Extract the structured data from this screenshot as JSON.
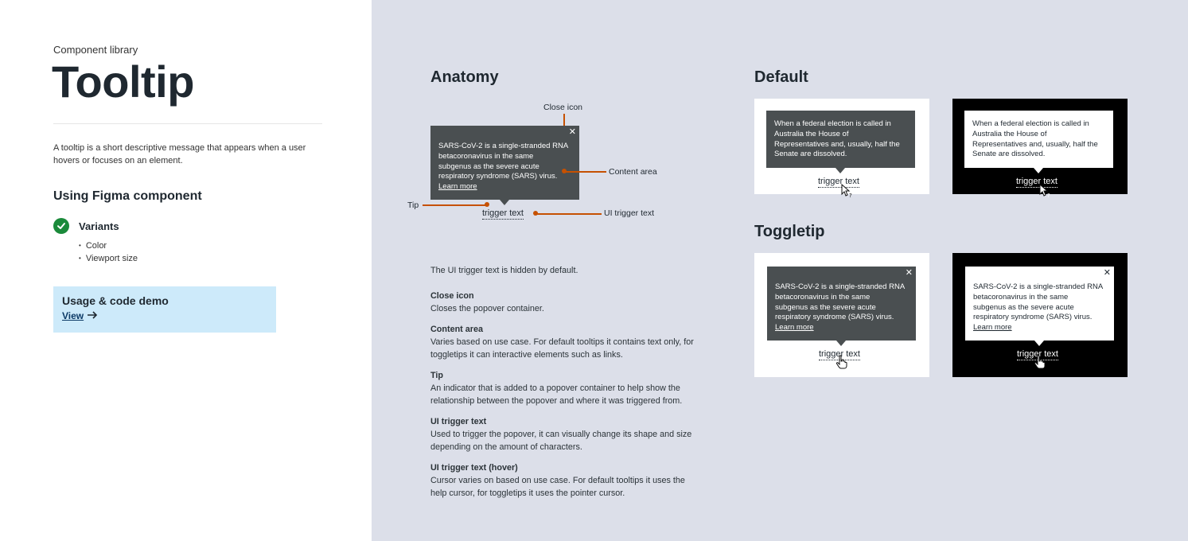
{
  "left": {
    "eyebrow": "Component library",
    "title": "Tooltip",
    "intro": "A tooltip is a short descriptive message that appears when a user hovers or focuses on an element.",
    "section_heading": "Using Figma component",
    "variants_label": "Variants",
    "variants": [
      "Color",
      "Viewport size"
    ],
    "usage_title": "Usage & code demo",
    "usage_link": "View",
    "icon_check": "checkmark-circle-icon",
    "icon_arrow": "arrow-right-icon"
  },
  "anatomy": {
    "heading": "Anatomy",
    "tooltip_text_lines": [
      "SARS-CoV-2 is a single-stranded RNA",
      "betacoronavirus in the same",
      "subgenus as the severe acute",
      "respiratory syndrome (SARS) virus."
    ],
    "learn_more": "Learn more",
    "trigger": "trigger text",
    "labels": {
      "close_icon": "Close icon",
      "content_area": "Content area",
      "tip": "Tip",
      "ui_trigger": "UI trigger text"
    },
    "accent_color": "#c65102"
  },
  "description": {
    "intro": "The UI trigger text is hidden by default.",
    "items": [
      {
        "title": "Close icon",
        "body": "Closes the popover container."
      },
      {
        "title": "Content area",
        "body": "Varies based on use case. For default tooltips it contains text only, for toggletips it can interactive elements such as links."
      },
      {
        "title": "Tip",
        "body": "An indicator that is added to a popover container to help show the relationship between the popover and where it was triggered from."
      },
      {
        "title": "UI trigger text",
        "body": "Used to trigger the popover, it can visually change its shape and size depending on the amount of characters."
      },
      {
        "title": "UI trigger text (hover)",
        "body": "Cursor varies on based on use case. For default tooltips it uses the help cursor, for toggletips it uses the pointer cursor."
      }
    ]
  },
  "default": {
    "heading": "Default",
    "text_lines": [
      "When a federal election is called in",
      "Australia the House of",
      "Representatives and, usually, half the",
      "Senate are dissolved."
    ],
    "trigger": "trigger text",
    "cursor_icon": "help-cursor-icon"
  },
  "toggletip": {
    "heading": "Toggletip",
    "text_lines": [
      "SARS-CoV-2 is a single-stranded RNA",
      "betacoronavirus in the same",
      "subgenus as the severe acute",
      "respiratory syndrome (SARS) virus."
    ],
    "learn_more": "Learn more",
    "trigger": "trigger text",
    "cursor_icon": "pointer-hand-icon"
  },
  "colors": {
    "dark_tooltip": "#4a4f51",
    "panel_bg": "#dcdfe9",
    "usage_bg": "#cdeafa",
    "success": "#1a8a3a"
  }
}
